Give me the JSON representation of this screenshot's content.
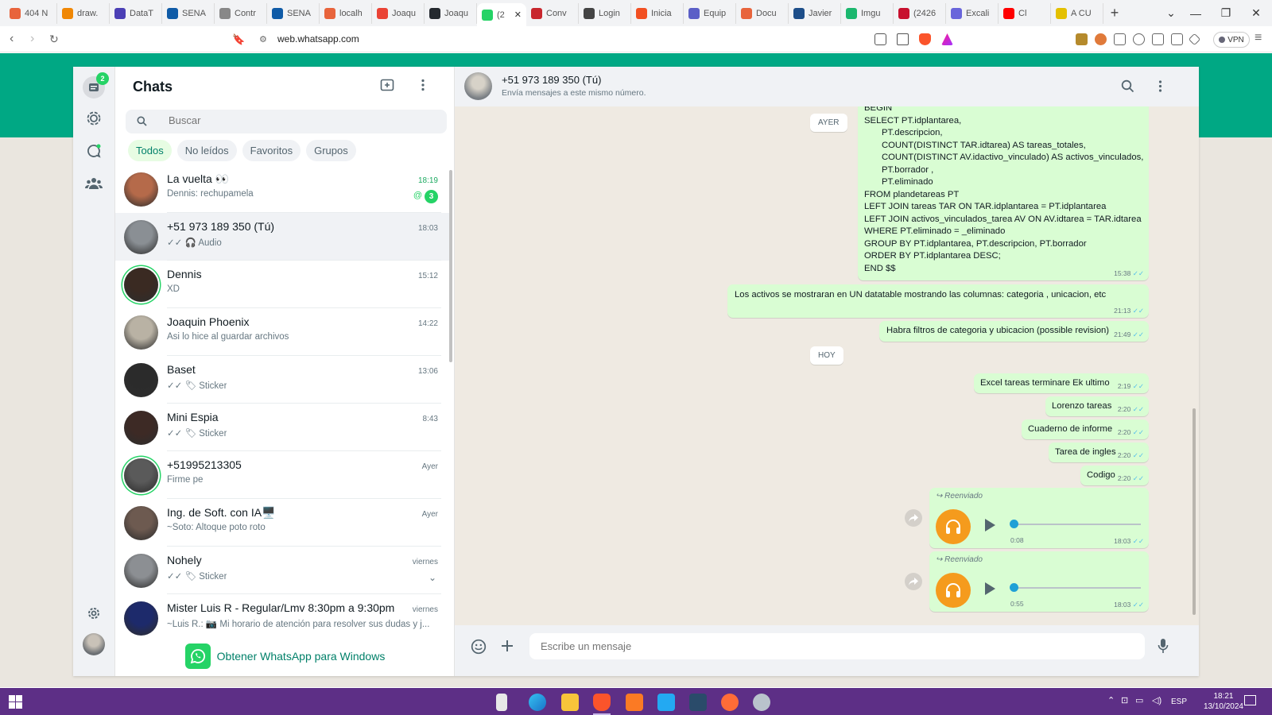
{
  "browser": {
    "tabs": [
      {
        "label": "404 N",
        "color": "#e8643c"
      },
      {
        "label": "draw.",
        "color": "#f08705"
      },
      {
        "label": "DataT",
        "color": "#4b3fb5"
      },
      {
        "label": "SENA",
        "color": "#0f5ba7"
      },
      {
        "label": "Contr",
        "color": "#888888"
      },
      {
        "label": "SENA",
        "color": "#0f5ba7"
      },
      {
        "label": "localh",
        "color": "#e8643c"
      },
      {
        "label": "Joaqu",
        "color": "#ea4335"
      },
      {
        "label": "Joaqu",
        "color": "#24292f"
      },
      {
        "label": "(2",
        "color": "#25d366",
        "active": true
      },
      {
        "label": "Conv",
        "color": "#c8262d"
      },
      {
        "label": "Login",
        "color": "#444444"
      },
      {
        "label": "Inicia",
        "color": "#f25022"
      },
      {
        "label": "Equip",
        "color": "#5b5fc7"
      },
      {
        "label": "Docu",
        "color": "#e8643c"
      },
      {
        "label": "Javier",
        "color": "#1d4e89"
      },
      {
        "label": "Imgu",
        "color": "#1bb76e"
      },
      {
        "label": "(2426",
        "color": "#c8102e"
      },
      {
        "label": "Excali",
        "color": "#6965db"
      },
      {
        "label": "Cl",
        "color": "#ff0000"
      },
      {
        "label": "A CU",
        "color": "#e4c000"
      }
    ],
    "url": "web.whatsapp.com",
    "vpn_label": "VPN"
  },
  "rail": {
    "unread_count": "2"
  },
  "chatlist": {
    "title": "Chats",
    "search_placeholder": "Buscar",
    "filters": [
      "Todos",
      "No leídos",
      "Favoritos",
      "Grupos"
    ],
    "chats": [
      {
        "name": "La vuelta 👀",
        "preview": "Dennis: rechupamela",
        "time": "18:19",
        "unread": "3",
        "time_green": true,
        "avatar": "#b56a4a"
      },
      {
        "name": "+51 973 189 350 (Tú)",
        "preview": "✓✓ 🎧 Audio",
        "time": "18:03",
        "selected": true,
        "avatar": "#8a8f94"
      },
      {
        "name": "Dennis",
        "preview": "XD",
        "time": "15:12",
        "avatar": "#3a2a22",
        "ring": true
      },
      {
        "name": "Joaquin Phoenix",
        "preview": "Asi lo hice al guardar archivos",
        "time": "14:22",
        "avatar": "#b9b2a4"
      },
      {
        "name": "Baset",
        "preview": "✓✓ 🏷 Sticker",
        "time": "13:06",
        "avatar": "#2b2b2b"
      },
      {
        "name": "Mini Espia",
        "preview": "✓✓ 🏷 Sticker",
        "time": "8:43",
        "avatar": "#3d2a25"
      },
      {
        "name": "+51995213305",
        "preview": "Firme pe",
        "time": "Ayer",
        "avatar": "#5a5a5a",
        "ring": true
      },
      {
        "name": "Ing. de Soft. con IA🖥️",
        "preview": "~Soto: Altoque poto roto",
        "time": "Ayer",
        "avatar": "#6d5a50"
      },
      {
        "name": "Nohely",
        "preview": "✓✓ 🏷 Sticker",
        "time": "viernes",
        "avatar": "#8c8f93"
      },
      {
        "name": "Mister Luis R - Regular/Lmv 8:30pm a 9:30pm",
        "preview": "~Luis R.: 📷 Mi horario de atención para resolver sus dudas y j...",
        "time": "viernes",
        "avatar": "#1d2a6b"
      }
    ],
    "get_app": "Obtener WhatsApp para Windows"
  },
  "conversation": {
    "name": "+51 973 189 350 (Tú)",
    "subtitle": "Envía mensajes a este mismo número.",
    "day_ayer": "AYER",
    "day_hoy": "HOY",
    "sql_text": "BEGIN\nSELECT PT.idplantarea,\n       PT.descripcion,\n       COUNT(DISTINCT TAR.idtarea) AS tareas_totales,\n       COUNT(DISTINCT AV.idactivo_vinculado) AS activos_vinculados,\n       PT.borrador ,\n       PT.eliminado\nFROM plandetareas PT\nLEFT JOIN tareas TAR ON TAR.idplantarea = PT.idplantarea\nLEFT JOIN activos_vinculados_tarea AV ON AV.idtarea = TAR.idtarea\nWHERE PT.eliminado = _eliminado\nGROUP BY PT.idplantarea, PT.descripcion, PT.borrador\nORDER BY PT.idplantarea DESC;\nEND $$",
    "sql_time": "15:38",
    "msg1": {
      "text": "Los activos se mostraran en UN datatable mostrando las columnas: categoria , unicacion, etc",
      "time": "21:13"
    },
    "msg2": {
      "text": "Habra filtros de categoria y ubicacion (possible revision)",
      "time": "21:49"
    },
    "today": [
      {
        "text": "Excel tareas terminare Ek ultimo",
        "time": "2:19"
      },
      {
        "text": "Lorenzo tareas",
        "time": "2:20"
      },
      {
        "text": "Cuaderno de informe",
        "time": "2:20"
      },
      {
        "text": "Tarea de ingles",
        "time": "2:20"
      },
      {
        "text": "Codigo",
        "time": "2:20"
      }
    ],
    "audios": [
      {
        "forwarded": "Reenviado",
        "duration": "0:08",
        "time": "18:03",
        "progress": 0
      },
      {
        "forwarded": "Reenviado",
        "duration": "0:55",
        "time": "18:03",
        "progress": 0
      }
    ],
    "input_placeholder": "Escribe un mensaje"
  },
  "taskbar": {
    "time": "18:21",
    "date": "13/10/2024",
    "lang": "ESP"
  }
}
